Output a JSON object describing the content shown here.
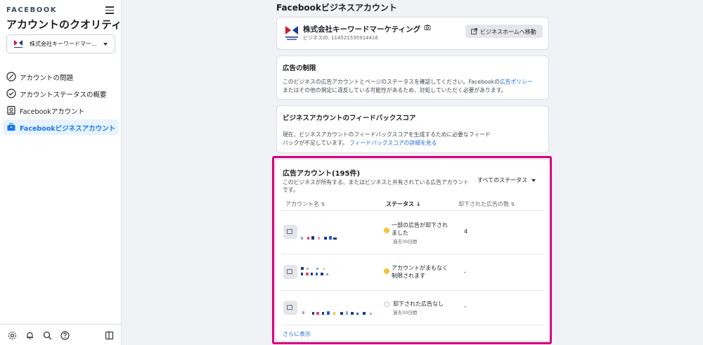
{
  "sidebar": {
    "brand": "FACEBOOK",
    "title": "アカウントのクオリティ",
    "selected_account": "株式会社キーワードマー...",
    "items": [
      {
        "label": "アカウントの問題",
        "icon": "alert-circle-icon"
      },
      {
        "label": "アカウントステータスの概要",
        "icon": "clock-check-icon"
      },
      {
        "label": "Facebookアカウント",
        "icon": "profile-card-icon"
      },
      {
        "label": "Facebookビジネスアカウント",
        "icon": "briefcase-icon",
        "active": true
      }
    ],
    "bottom_icons": [
      "gear-icon",
      "bell-icon",
      "search-icon",
      "help-icon",
      "panel-toggle-icon"
    ]
  },
  "main": {
    "title": "Facebookビジネスアカウント",
    "business": {
      "name": "株式会社キーワードマーケティング",
      "id_text": "ビジネスID: 114521535914416",
      "home_button": "ビジネスホームへ移動"
    },
    "restrictions": {
      "title": "広告の制限",
      "text_before_link": "このビジネスの広告アカウントとページのステータスを確認してください。Facebookの",
      "link": "広告ポリシー",
      "text_after_link": "またはその他の規定に違反している可能性があるため、対処していただく必要があります。"
    },
    "feedback": {
      "title": "ビジネスアカウントのフィードバックスコア",
      "text": "現在、ビジネスアカウントのフィードバックスコアを生成するために必要なフィードバックが不足しています。",
      "link": "フィードバックスコアの詳細を見る"
    },
    "ad_accounts": {
      "title": "広告アカウント(195件)",
      "description": "このビジネスが所有する、またはビジネスと共有されている広告アカウントです。",
      "filter": "すべてのステータス",
      "headers": {
        "name": "アカウント名",
        "status": "ステータス",
        "rejected": "却下された広告の数"
      },
      "rows": [
        {
          "status": "一部の広告が却下されました",
          "sub": "過去30日間",
          "count": "4",
          "status_color": "#f5c33b"
        },
        {
          "status": "アカウントがまもなく制限されます",
          "sub": "",
          "count": "-",
          "status_color": "#f5c33b"
        },
        {
          "status": "却下された広告なし",
          "sub": "過去30日間",
          "count": "-",
          "status_color": "#ffffff"
        }
      ],
      "more": "さらに表示"
    }
  },
  "colors": {
    "accent": "#1877f2",
    "highlight_border": "#d6007f",
    "link": "#216fdb"
  }
}
